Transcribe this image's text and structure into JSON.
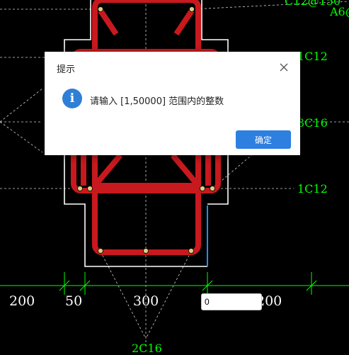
{
  "drawing": {
    "labels": {
      "top_right_text": "C12@150",
      "far_right_text": "A6@",
      "rebar_label_1": "1C12",
      "rebar_label_2": "3C16",
      "rebar_label_3": "1C12",
      "bottom_partial_text": "2C16"
    },
    "dimensions": [
      "200",
      "50",
      "300",
      "200"
    ],
    "colors": {
      "background": "#000000",
      "rebar": "#c8191e",
      "annotation": "#00ff00",
      "outline": "#ffffff",
      "highlight_edge": "#1e8fff"
    }
  },
  "input": {
    "value": "0"
  },
  "dialog": {
    "title": "提示",
    "icon": "info-icon",
    "icon_glyph": "i",
    "message": "请输入 [1,50000] 范围内的整数",
    "ok_label": "确定",
    "close_icon": "close-icon"
  }
}
